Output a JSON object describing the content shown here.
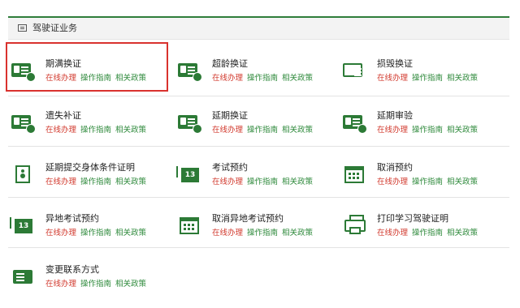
{
  "header": {
    "title": "驾驶证业务"
  },
  "link_labels": {
    "online": "在线办理",
    "guide": "操作指南",
    "policy": "相关政策"
  },
  "items": [
    {
      "name": "期满换证",
      "icon": "license-card-clock-icon"
    },
    {
      "name": "超龄换证",
      "icon": "license-card-renew-icon"
    },
    {
      "name": "损毁换证",
      "icon": "damaged-license-icon"
    },
    {
      "name": "遗失补证",
      "icon": "lost-license-icon"
    },
    {
      "name": "延期换证",
      "icon": "license-card-extend-icon"
    },
    {
      "name": "延期审验",
      "icon": "license-card-audit-icon"
    },
    {
      "name": "延期提交身体条件证明",
      "icon": "health-certificate-icon"
    },
    {
      "name": "考试预约",
      "icon": "calendar-13-icon"
    },
    {
      "name": "取消预约",
      "icon": "calendar-cancel-icon"
    },
    {
      "name": "异地考试预约",
      "icon": "remote-exam-calendar-icon"
    },
    {
      "name": "取消异地考试预约",
      "icon": "calendar-cancel-icon"
    },
    {
      "name": "打印学习驾驶证明",
      "icon": "printer-icon"
    },
    {
      "name": "变更联系方式",
      "icon": "edit-contact-icon"
    }
  ],
  "colors": {
    "accent": "#2c7a36",
    "online_link": "#d23a2e",
    "highlight": "#d9322e"
  }
}
